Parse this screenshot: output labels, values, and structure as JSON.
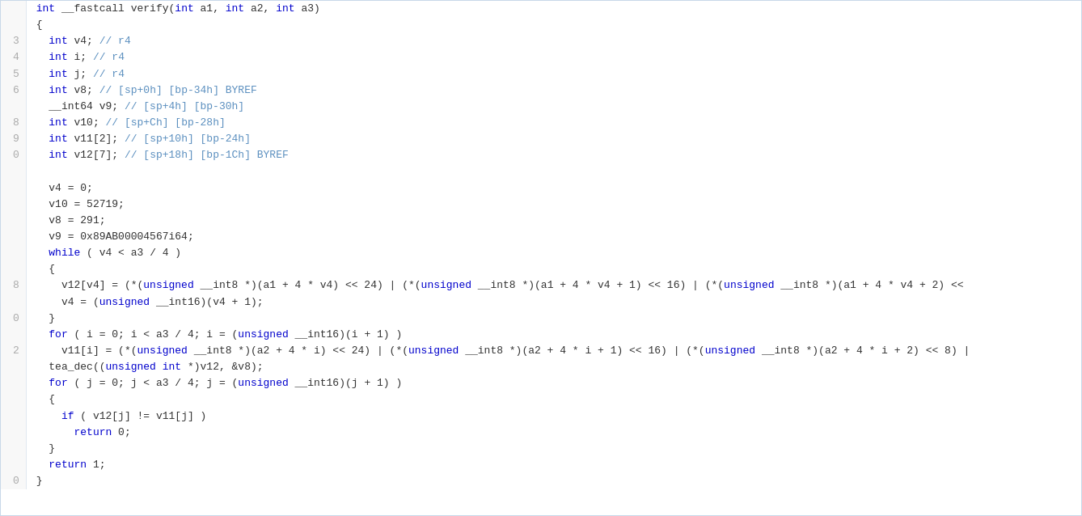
{
  "code": {
    "lines": [
      {
        "num": "",
        "text": "int __fastcall verify(int a1, int a2, int a3)",
        "html": "<span class='kw'>int</span> __fastcall verify(<span class='kw'>int</span> a1, <span class='kw'>int</span> a2, <span class='kw'>int</span> a3)"
      },
      {
        "num": "",
        "text": "{",
        "html": "{"
      },
      {
        "num": "3",
        "text": "  int v4; // r4",
        "html": "  <span class='kw'>int</span> v4; <span class='cm'>// r4</span>"
      },
      {
        "num": "4",
        "text": "  int i; // r4",
        "html": "  <span class='kw'>int</span> i; <span class='cm'>// r4</span>"
      },
      {
        "num": "5",
        "text": "  int j; // r4",
        "html": "  <span class='kw'>int</span> j; <span class='cm'>// r4</span>"
      },
      {
        "num": "6",
        "text": "  int v8; // [sp+0h] [bp-34h] BYREF",
        "html": "  <span class='kw'>int</span> v8; <span class='cm'>// [sp+0h] [bp-34h] BYREF</span>"
      },
      {
        "num": "",
        "text": "  __int64 v9; // [sp+4h] [bp-30h]",
        "html": "  __int64 v9; <span class='cm'>// [sp+4h] [bp-30h]</span>"
      },
      {
        "num": "8",
        "text": "  int v10; // [sp+Ch] [bp-28h]",
        "html": "  <span class='kw'>int</span> v10; <span class='cm'>// [sp+Ch] [bp-28h]</span>"
      },
      {
        "num": "9",
        "text": "  int v11[2]; // [sp+10h] [bp-24h]",
        "html": "  <span class='kw'>int</span> v11[2]; <span class='cm'>// [sp+10h] [bp-24h]</span>"
      },
      {
        "num": "0",
        "text": "  int v12[7]; // [sp+18h] [bp-1Ch] BYREF",
        "html": "  <span class='kw'>int</span> v12[7]; <span class='cm'>// [sp+18h] [bp-1Ch] BYREF</span>"
      },
      {
        "num": "",
        "text": "",
        "html": ""
      },
      {
        "num": "",
        "text": "  v4 = 0;",
        "html": "  v4 = 0;"
      },
      {
        "num": "",
        "text": "  v10 = 52719;",
        "html": "  v10 = 52719;"
      },
      {
        "num": "",
        "text": "  v8 = 291;",
        "html": "  v8 = 291;"
      },
      {
        "num": "",
        "text": "  v9 = 0x89AB00004567i64;",
        "html": "  v9 = 0x89AB00004567i64;"
      },
      {
        "num": "",
        "text": "  while ( v4 < a3 / 4 )",
        "html": "  <span class='kw'>while</span> ( v4 &lt; a3 / 4 )"
      },
      {
        "num": "",
        "text": "  {",
        "html": "  {"
      },
      {
        "num": "8",
        "text": "    v12[v4] = (*(unsigned __int8 *)(a1 + 4 * v4) << 24) | (*(unsigned __int8 *)(a1 + 4 * v4 + 1) << 16) | (*(unsigned __int8 *)(a1 + 4 * v4 + 2) <<",
        "html": "    v12[v4] = (*(<span class='kw'>unsigned</span> __int8 *)(a1 + 4 * v4) &lt;&lt; 24) | (*(<span class='kw'>unsigned</span> __int8 *)(a1 + 4 * v4 + 1) &lt;&lt; 16) | (*(<span class='kw'>unsigned</span> __int8 *)(a1 + 4 * v4 + 2) &lt;&lt;"
      },
      {
        "num": "",
        "text": "    v4 = (unsigned __int16)(v4 + 1);",
        "html": "    v4 = (<span class='kw'>unsigned</span> __int16)(v4 + 1);"
      },
      {
        "num": "0",
        "text": "  }",
        "html": "  }"
      },
      {
        "num": "",
        "text": "  for ( i = 0; i < a3 / 4; i = (unsigned __int16)(i + 1) )",
        "html": "  <span class='kw'>for</span> ( i = 0; i &lt; a3 / 4; i = (<span class='kw'>unsigned</span> __int16)(i + 1) )"
      },
      {
        "num": "2",
        "text": "    v11[i] = (*(unsigned __int8 *)(a2 + 4 * i) << 24) | (*(unsigned __int8 *)(a2 + 4 * i + 1) << 16) | (*(unsigned __int8 *)(a2 + 4 * i + 2) << 8) |",
        "html": "    v11[i] = (*(<span class='kw'>unsigned</span> __int8 *)(a2 + 4 * i) &lt;&lt; 24) | (*(<span class='kw'>unsigned</span> __int8 *)(a2 + 4 * i + 1) &lt;&lt; 16) | (*(<span class='kw'>unsigned</span> __int8 *)(a2 + 4 * i + 2) &lt;&lt; 8) |"
      },
      {
        "num": "",
        "text": "  tea_dec((unsigned int *)v12, &v8);",
        "html": "  tea_dec((<span class='kw'>unsigned</span> <span class='kw'>int</span> *)v12, &amp;v8);"
      },
      {
        "num": "",
        "text": "  for ( j = 0; j < a3 / 4; j = (unsigned __int16)(j + 1) )",
        "html": "  <span class='kw'>for</span> ( j = 0; j &lt; a3 / 4; j = (<span class='kw'>unsigned</span> __int16)(j + 1) )"
      },
      {
        "num": "",
        "text": "  {",
        "html": "  {"
      },
      {
        "num": "",
        "text": "    if ( v12[j] != v11[j] )",
        "html": "    <span class='kw'>if</span> ( v12[j] != v11[j] )"
      },
      {
        "num": "",
        "text": "      return 0;",
        "html": "      <span class='kw'>return</span> 0;"
      },
      {
        "num": "",
        "text": "  }",
        "html": "  }"
      },
      {
        "num": "",
        "text": "  return 1;",
        "html": "  <span class='kw'>return</span> 1;"
      },
      {
        "num": "0",
        "text": "}",
        "html": "}"
      }
    ]
  },
  "colors": {
    "background": "#ffffff",
    "lineNumberBg": "#f8f8f8",
    "border": "#c8d8e8",
    "keyword": "#0000cc",
    "comment": "#5b8fbf",
    "normal": "#333333"
  }
}
